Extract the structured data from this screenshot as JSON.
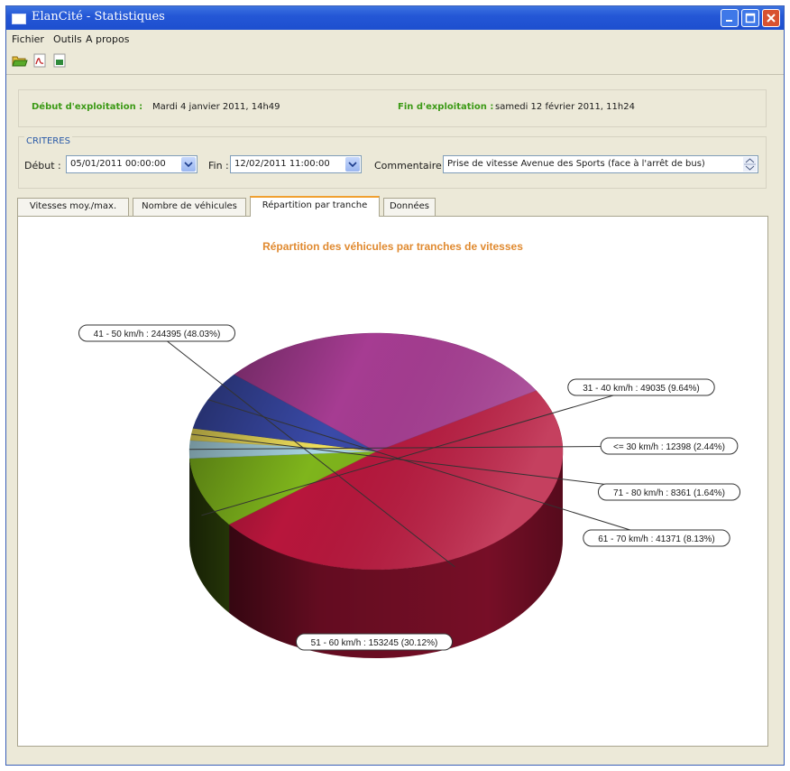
{
  "window": {
    "title": "ElanCité - Statistiques"
  },
  "menu": {
    "fichier": "Fichier",
    "outils": "Outils",
    "apropos": "A propos"
  },
  "toolbar": {
    "icons": [
      "folder-open-icon",
      "pdf-export-icon",
      "excel-export-icon"
    ]
  },
  "info": {
    "debut_label": "Début d'exploitation :",
    "debut_value": "Mardi 4 janvier 2011, 14h49",
    "fin_label": "Fin d'exploitation :",
    "fin_value": "samedi 12 février 2011, 11h24"
  },
  "criteria": {
    "legend": "CRITERES",
    "debut_label": "Début :",
    "debut_value": "05/01/2011 00:00:00",
    "fin_label": "Fin :",
    "fin_value": "12/02/2011 11:00:00",
    "commentaire_label": "Commentaire :",
    "commentaire_value": "Prise de vitesse Avenue des Sports (face à l'arrêt de bus)"
  },
  "tabs": [
    {
      "label": "Vitesses moy./max."
    },
    {
      "label": "Nombre de véhicules"
    },
    {
      "label": "Répartition par tranche"
    },
    {
      "label": "Données"
    }
  ],
  "active_tab": 2,
  "chart_data": {
    "type": "pie",
    "title": "Répartition des véhicules par tranches de vitesses",
    "slices": [
      {
        "label": "41 - 50 km/h : 244395 (48.03%)",
        "value": 244395,
        "percent": 48.03,
        "color": "#b8163c"
      },
      {
        "label": "31 - 40 km/h : 49035 (9.64%)",
        "value": 49035,
        "percent": 9.64,
        "color": "#7fb51c"
      },
      {
        "label": "<= 30 km/h : 12398 (2.44%)",
        "value": 12398,
        "percent": 2.44,
        "color": "#a9d6e3"
      },
      {
        "label": "71 - 80 km/h : 8361 (1.64%)",
        "value": 8361,
        "percent": 1.64,
        "color": "#f0df5a"
      },
      {
        "label": "61 - 70 km/h : 41371 (8.13%)",
        "value": 41371,
        "percent": 8.13,
        "color": "#3a4aa8"
      },
      {
        "label": "51 - 60 km/h : 153245 (30.12%)",
        "value": 153245,
        "percent": 30.12,
        "color": "#a63c92"
      }
    ],
    "legend": "none"
  },
  "colors": {
    "accent_green": "#3c9a16",
    "title_orange": "#e08a30",
    "titlebar_blue": "#2457d6"
  }
}
